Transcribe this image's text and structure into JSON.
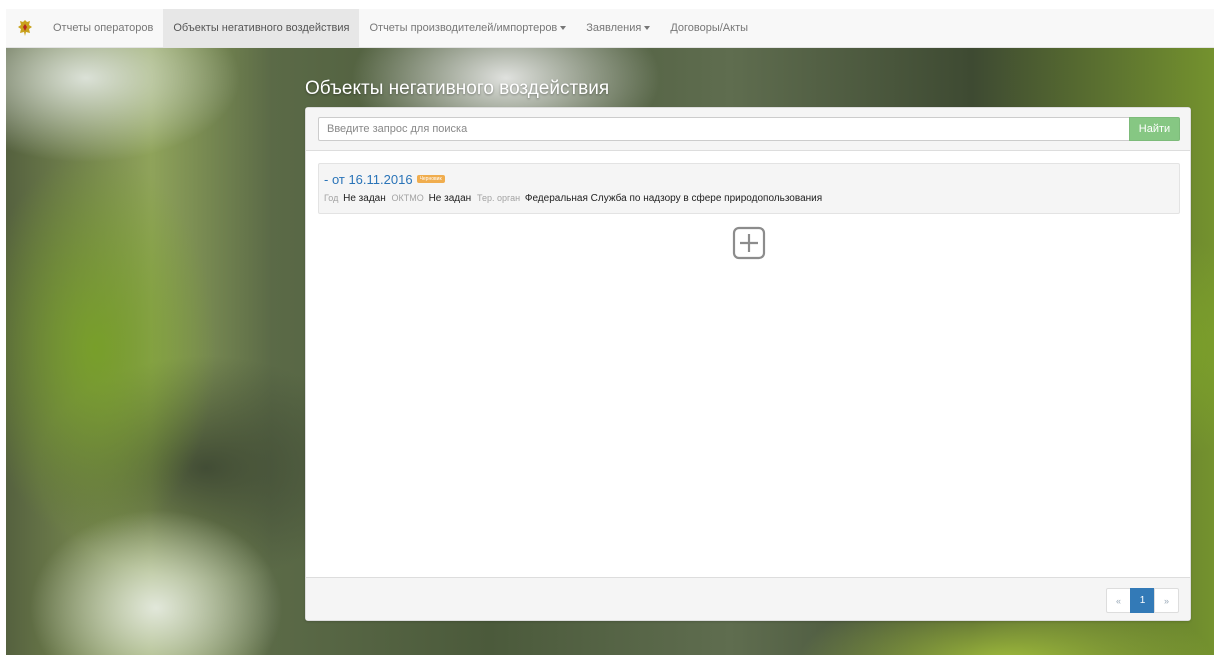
{
  "nav": {
    "brand_icon": "emblem-icon",
    "items": [
      {
        "label": "Отчеты операторов",
        "active": false,
        "dropdown": false
      },
      {
        "label": "Объекты негативного воздействия",
        "active": true,
        "dropdown": false
      },
      {
        "label": "Отчеты производителей/импортеров",
        "active": false,
        "dropdown": true
      },
      {
        "label": "Заявления",
        "active": false,
        "dropdown": true
      },
      {
        "label": "Договоры/Акты",
        "active": false,
        "dropdown": false
      }
    ]
  },
  "page": {
    "title": "Объекты негативного воздействия"
  },
  "search": {
    "placeholder": "Введите запрос для поиска",
    "value": "",
    "button_label": "Найти"
  },
  "records": [
    {
      "title": "- от 16.11.2016",
      "badge": "Черновик",
      "year_label": "Год",
      "year_value": "Не задан",
      "oktmo_label": "ОКТМО",
      "oktmo_value": "Не задан",
      "org_label": "Тер. орган",
      "org_value": "Федеральная Служба по надзору в сфере природопользования"
    }
  ],
  "add_icon": "plus-square-icon",
  "pagination": {
    "prev": "«",
    "current": "1",
    "next": "»"
  },
  "colors": {
    "accent": "#337ab7",
    "link": "#2a74b8",
    "badge": "#f0ad4e",
    "search_button": "#86c783"
  }
}
